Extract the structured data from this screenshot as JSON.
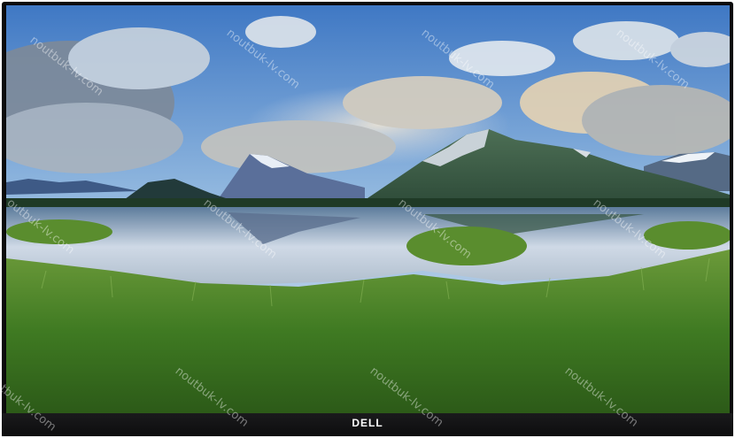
{
  "monitor": {
    "brand_logo": "DELL"
  },
  "watermarks": {
    "text": "noutbuk-lv.com",
    "partial_text": "outbuk-lv.com",
    "edge_text": "tbuk-lv.com"
  },
  "colors": {
    "bezel": "#0b0b0c",
    "sky": "#6e9fd3",
    "grass": "#4f8a2a"
  }
}
